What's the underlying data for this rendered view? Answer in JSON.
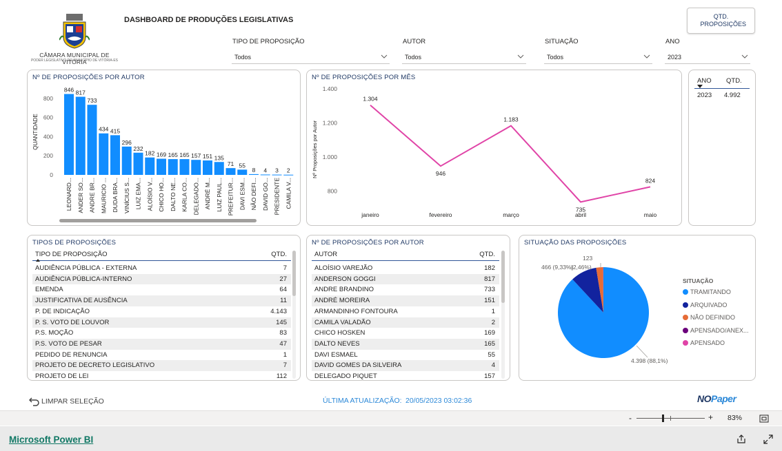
{
  "header": {
    "org_name": "CÂMARA MUNICIPAL DE VITÓRIA",
    "org_tagline": "PODER LEGISLATIVO DO MUNICÍPIO DE VITÓRIA-ES",
    "title": "DASHBOARD DE PRODUÇÕES LEGISLATIVAS",
    "qtd_button": "QTD. PROPOSIÇÕES"
  },
  "filters": [
    {
      "label": "TIPO DE PROPOSIÇÃO",
      "value": "Todos"
    },
    {
      "label": "AUTOR",
      "value": "Todos"
    },
    {
      "label": "SITUAÇÃO",
      "value": "Todos"
    },
    {
      "label": "ANO",
      "value": "2023"
    }
  ],
  "bar_chart": {
    "title": "Nº DE PROPOSIÇÕES POR AUTOR",
    "ylabel": "QUANTIDADE"
  },
  "line_chart": {
    "title": "Nº DE PROPOSIÇÕES POR MÊS",
    "ylabel": "Nº Proposições por Autor"
  },
  "year_table": {
    "headers": [
      "ANO",
      "QTD."
    ],
    "rows": [
      [
        "2023",
        "4.992"
      ]
    ]
  },
  "tipos_table": {
    "title": "TIPOS DE PROPOSIÇÕES",
    "headers": [
      "TIPO DE PROPOSIÇÃO",
      "QTD."
    ],
    "rows": [
      [
        "AUDIÊNCIA PÚBLICA - EXTERNA",
        "7"
      ],
      [
        "AUDIÊNCIA PÚBLICA-INTERNO",
        "27"
      ],
      [
        "EMENDA",
        "64"
      ],
      [
        "JUSTIFICATIVA DE AUSÊNCIA",
        "11"
      ],
      [
        "P. DE INDICAÇÃO",
        "4.143"
      ],
      [
        "P. S. VOTO DE LOUVOR",
        "145"
      ],
      [
        "P.S. MOÇÃO",
        "83"
      ],
      [
        "P.S. VOTO DE PESAR",
        "47"
      ],
      [
        "PEDIDO DE RENUNCIA",
        "1"
      ],
      [
        "PROJETO DE DECRETO LEGISLATIVO",
        "7"
      ],
      [
        "PROJETO DE LEI",
        "112"
      ]
    ]
  },
  "autor_table": {
    "title": "Nº DE PROPOSIÇÕES POR AUTOR",
    "headers": [
      "AUTOR",
      "QTD."
    ],
    "rows": [
      [
        "ALOÍSIO VAREJÃO",
        "182"
      ],
      [
        "ANDERSON GOGGI",
        "817"
      ],
      [
        "ANDRE BRANDINO",
        "733"
      ],
      [
        "ANDRÉ MOREIRA",
        "151"
      ],
      [
        "ARMANDINHO FONTOURA",
        "1"
      ],
      [
        "CAMILA VALADÃO",
        "2"
      ],
      [
        "CHICO HOSKEN",
        "169"
      ],
      [
        "DALTO NEVES",
        "165"
      ],
      [
        "DAVI ESMAEL",
        "55"
      ],
      [
        "DAVID GOMES DA SILVEIRA",
        "4"
      ],
      [
        "DELEGADO PIQUET",
        "157"
      ]
    ]
  },
  "pie": {
    "title": "SITUAÇÃO DAS PROPOSIÇÕES",
    "legend_title": "SITUAÇÃO",
    "labels": {
      "big": "4.398 (88,1%)",
      "mid": "466 (9,33%)",
      "small_pct": "(2,46%)",
      "small_val": "123"
    }
  },
  "footer": {
    "clear": "LIMPAR SELEÇÃO",
    "update_label": "ÚLTIMA ATUALIZAÇÃO:",
    "update_value": "20/05/2023 03:02:36",
    "brand_no": "NO",
    "brand_paper": "Paper",
    "zoom": "83%",
    "powerbi_link": "Microsoft Power BI"
  },
  "chart_data": [
    {
      "type": "bar",
      "title": "Nº DE PROPOSIÇÕES POR AUTOR",
      "ylabel": "QUANTIDADE",
      "ylim": [
        0,
        900
      ],
      "yticks": [
        0,
        200,
        400,
        600,
        800
      ],
      "color": "#118dff",
      "categories": [
        "LEONARD...",
        "ANDER SO...",
        "ANDRE BR...",
        "MAURICIO ...",
        "DUDA BRA...",
        "VINÍCIUS S...",
        "LUIZ EMA...",
        "ALOÍSIO V...",
        "CHICO HO...",
        "DALTO NE...",
        "KARLA CO...",
        "DELEGADO...",
        "ANDRÉ M...",
        "LUIZ PAUL...",
        "PREFEITUR...",
        "DAVI ESM...",
        "NÃO DEFI...",
        "DAVID GO...",
        "PRESIDENTE",
        "CAMILA V..."
      ],
      "values": [
        846,
        817,
        733,
        434,
        415,
        296,
        232,
        182,
        169,
        165,
        165,
        157,
        151,
        135,
        71,
        55,
        8,
        4,
        3,
        2
      ]
    },
    {
      "type": "line",
      "title": "Nº DE PROPOSIÇÕES POR MÊS",
      "ylabel": "Nº Proposições por Autor",
      "ylim": [
        700,
        1400
      ],
      "yticks": [
        800,
        1000,
        1200,
        1400
      ],
      "color": "#e044a7",
      "x": [
        "janeiro",
        "fevereiro",
        "março",
        "abril",
        "maio"
      ],
      "values": [
        1304,
        946,
        1183,
        735,
        824
      ]
    },
    {
      "type": "pie",
      "title": "SITUAÇÃO DAS PROPOSIÇÕES",
      "legend_title": "SITUAÇÃO",
      "legend": "right",
      "slices": [
        {
          "label": "TRAMITANDO",
          "value": 4398,
          "pct": 88.1,
          "color": "#118dff"
        },
        {
          "label": "ARQUIVADO",
          "value": 466,
          "pct": 9.33,
          "color": "#12239e"
        },
        {
          "label": "NÃO DEFINIDO",
          "value": 123,
          "pct": 2.46,
          "color": "#e66c37"
        },
        {
          "label": "APENSADO/ANEX...",
          "value": 3,
          "pct": 0.06,
          "color": "#6b007b"
        },
        {
          "label": "APENSADO",
          "value": 2,
          "pct": 0.04,
          "color": "#e044a7"
        }
      ]
    }
  ]
}
